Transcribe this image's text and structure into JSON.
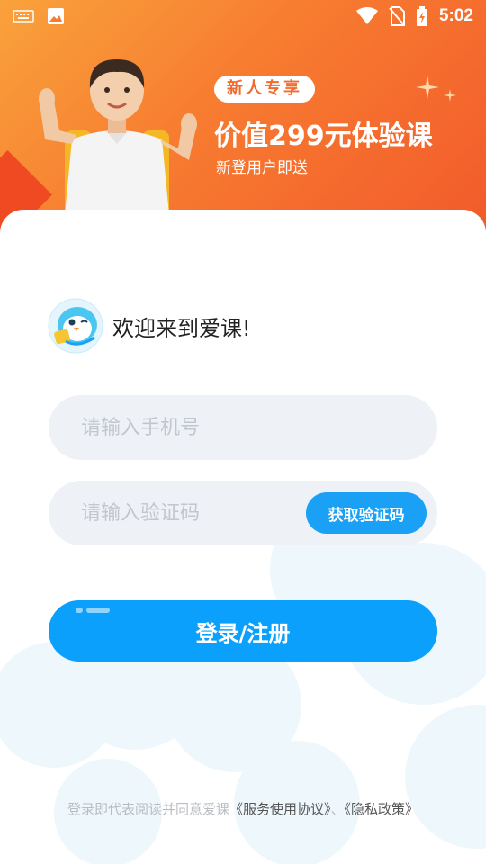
{
  "status_bar": {
    "time": "5:02"
  },
  "promo": {
    "badge": "新人专享",
    "title": "价值299元体验课",
    "subtitle": "新登用户即送"
  },
  "welcome": {
    "text": "欢迎来到爱课!"
  },
  "form": {
    "phone_placeholder": "请输入手机号",
    "code_placeholder": "请输入验证码",
    "get_code_label": "获取验证码",
    "login_label": "登录/注册"
  },
  "agreement": {
    "prefix": "登录即代表阅读并同意爱课",
    "service_link": "《服务使用协议》",
    "separator": "、",
    "privacy_link": "《隐私政策》"
  },
  "colors": {
    "header_orange": "#f77b30",
    "primary_blue": "#0aa0fb",
    "input_bg": "#eef1f6"
  }
}
